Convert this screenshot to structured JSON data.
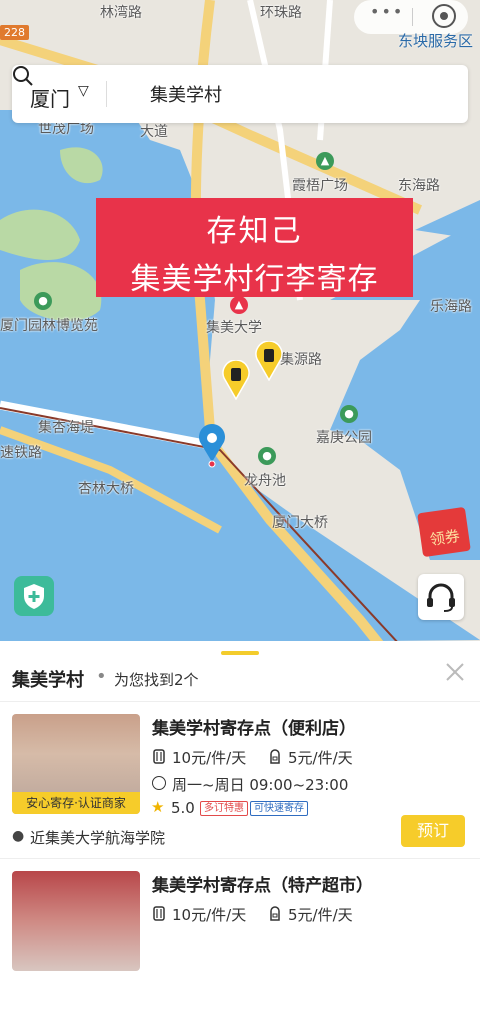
{
  "status": {
    "road_shield": "228",
    "service_area": "东坱服务区"
  },
  "search": {
    "city": "厦门",
    "query": "集美学村"
  },
  "banner": {
    "line1": "存知己",
    "line2": "集美学村行李寄存"
  },
  "map_labels": {
    "plaza": "霞梧广场",
    "sea_road": "东海路",
    "garden": "厦门园林博览苑",
    "university": "集美大学",
    "jiyuan": "集源路",
    "jiaxing": "嘉庚公园",
    "longzhou": "龙舟池",
    "jixing": "集杏海堤",
    "xinglin": "杏林大桥",
    "railway": "速铁路",
    "xiamen_bridge": "厦门大桥",
    "lehai": "乐海路",
    "huanzhu": "环珠路",
    "yugu": "林湾路",
    "shimao": "世茂广场",
    "dadao": "大道"
  },
  "coupon": {
    "label": "领券"
  },
  "sheet": {
    "title": "集美学村",
    "dot": "•",
    "count_text": "为您找到2个"
  },
  "stores": [
    {
      "name": "集美学村寄存点（便利店）",
      "price_large": "10元/件/天",
      "price_small": "5元/件/天",
      "hours": "周一~周日 09:00~23:00",
      "rating": "5.0",
      "badge_1": "多订特惠",
      "badge_2": "可快速寄存",
      "tag": "安心寄存·认证商家",
      "address": "近集美大学航海学院",
      "book_label": "预订"
    },
    {
      "name": "集美学村寄存点（特产超市）",
      "price_large": "10元/件/天",
      "price_small": "5元/件/天"
    }
  ],
  "colors": {
    "accent": "#f6cc2a",
    "banner": "#e8334a",
    "water": "#7bb8e8",
    "pin": "#2a8fd8"
  }
}
